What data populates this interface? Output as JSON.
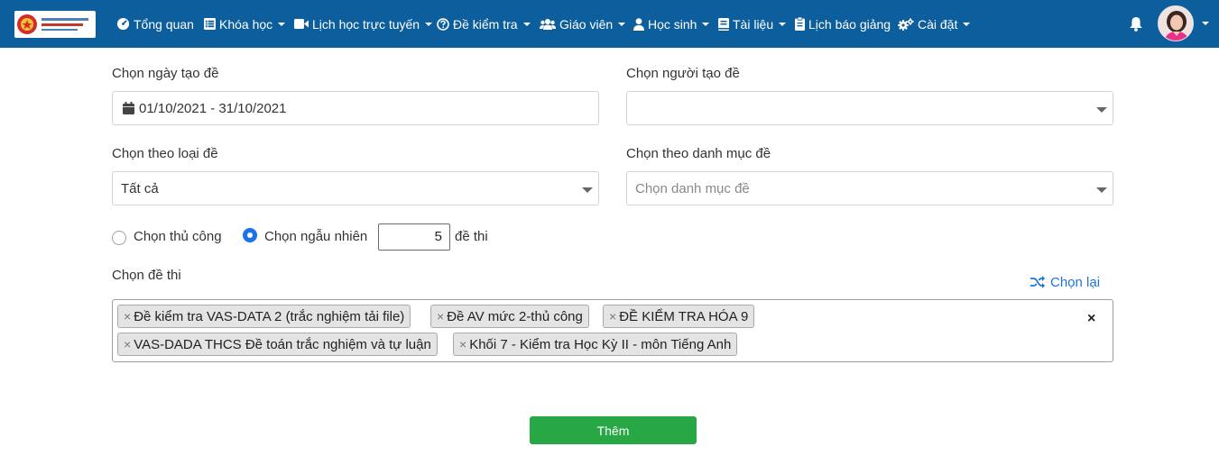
{
  "nav": {
    "items": [
      {
        "label": "Tổng quan",
        "icon": "dashboard-icon",
        "dropdown": false
      },
      {
        "label": "Khóa học",
        "icon": "list-icon",
        "dropdown": true
      },
      {
        "label": "Lịch học trực tuyến",
        "icon": "video-icon",
        "dropdown": true
      },
      {
        "label": "Đề kiểm tra",
        "icon": "question-circle-icon",
        "dropdown": true
      },
      {
        "label": "Giáo viên",
        "icon": "users-icon",
        "dropdown": true
      },
      {
        "label": "Học sinh",
        "icon": "user-icon",
        "dropdown": true
      },
      {
        "label": "Tài liệu",
        "icon": "book-icon",
        "dropdown": true
      },
      {
        "label": "Lịch báo giảng",
        "icon": "clipboard-icon",
        "dropdown": false
      },
      {
        "label": "Cài đặt",
        "icon": "cogs-icon",
        "dropdown": true
      }
    ]
  },
  "form": {
    "date_label": "Chọn ngày tạo đề",
    "date_value": "01/10/2021 - 31/10/2021",
    "creator_label": "Chọn người tạo đề",
    "creator_value": "",
    "type_label": "Chọn theo loại đề",
    "type_value": "Tất cả",
    "category_label": "Chọn theo danh mục đề",
    "category_placeholder": "Chọn danh mục đề",
    "mode_manual": "Chọn thủ công",
    "mode_random": "Chọn ngẫu nhiên",
    "random_count": "5",
    "random_suffix": "đề thi",
    "exams_label": "Chọn đề thi",
    "reset_label": "Chọn lại",
    "selected_exams": [
      "Đề kiểm tra VAS-DATA 2 (trắc nghiệm tải file)",
      "Đề AV mức 2-thủ công",
      "ĐỀ KIỂM TRA HÓA 9",
      "VAS-DADA THCS Đề toán trắc nghiệm và tự luận",
      "Khối 7 - Kiểm tra Học Kỳ II - môn Tiếng Anh"
    ],
    "tag_remove": "×",
    "clear_all": "×",
    "submit_label": "Thêm"
  },
  "colors": {
    "navbar": "#0d5e9c",
    "primary": "#1a73e8",
    "link": "#1e73d8",
    "success": "#28a745"
  }
}
